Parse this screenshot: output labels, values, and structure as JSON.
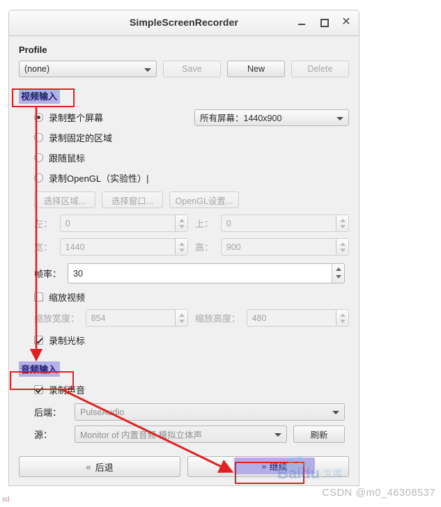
{
  "window": {
    "title": "SimpleScreenRecorder",
    "controls": {
      "minimize": "–",
      "maximize": "□",
      "close": "✕"
    }
  },
  "profile": {
    "label": "Profile",
    "combo_value": "(none)",
    "save_label": "Save",
    "new_label": "New",
    "delete_label": "Delete"
  },
  "video_input": {
    "group_label": "视频输入",
    "radios": [
      {
        "label": "录制整个屏幕",
        "selected": true,
        "disabled": false
      },
      {
        "label": "录制固定的区域",
        "selected": false,
        "disabled": false
      },
      {
        "label": "跟随鼠标",
        "selected": false,
        "disabled": false
      },
      {
        "label": "录制OpenGL（实验性）|",
        "selected": false,
        "disabled": false
      }
    ],
    "screen_combo_value": "所有屏幕：1440x900",
    "buttons": {
      "select_area": "选择区域...",
      "select_window": "选择窗口...",
      "opengl_settings": "OpenGL设置..."
    },
    "geometry": {
      "left_label": "左：",
      "left_value": "0",
      "top_label": "上：",
      "top_value": "0",
      "width_label": "宽：",
      "width_value": "1440",
      "height_label": "高：",
      "height_value": "900"
    },
    "framerate_label": "帧率：",
    "framerate_value": "30",
    "scale_checkbox": {
      "label": "缩放视频",
      "checked": false
    },
    "scaled_width_label": "缩放宽度：",
    "scaled_width_value": "854",
    "scaled_height_label": "缩放高度：",
    "scaled_height_value": "480",
    "cursor_checkbox": {
      "label": "录制光标",
      "checked": true
    }
  },
  "audio_input": {
    "group_label": "音频输入",
    "record_audio_checkbox": {
      "label": "录制声音",
      "checked": true
    },
    "backend_label": "后端：",
    "backend_value": "PulseAudio",
    "source_label": "源：",
    "source_value": "Monitor of 内置音频 模拟立体声",
    "refresh_label": "刷新"
  },
  "navigation": {
    "back_label": "后退",
    "back_icon": "chevron-left-double",
    "continue_label": "继续",
    "continue_icon": "chevron-right-double"
  },
  "annotations": {
    "highlight_color": "#b6b0e8",
    "box_color": "#e02020",
    "boxes": [
      "视频输入",
      "音频输入",
      "继续"
    ]
  },
  "watermarks": {
    "csdn": "CSDN @m0_46308537",
    "baidu": "Baidu",
    "corner": "sd"
  }
}
